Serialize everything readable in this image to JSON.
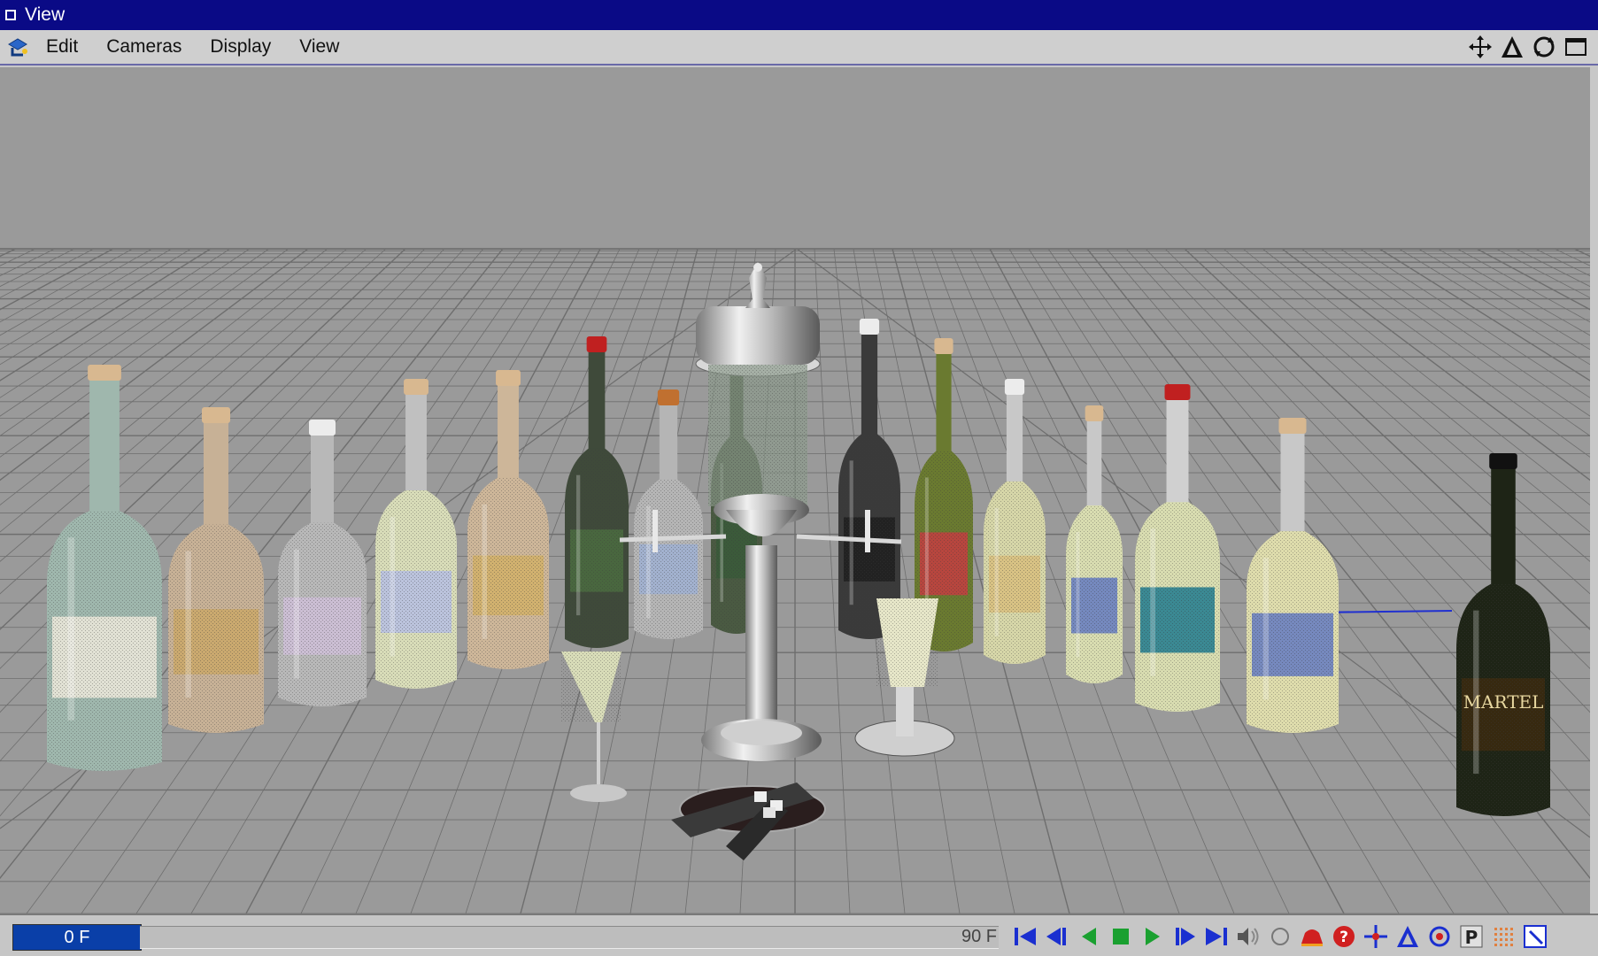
{
  "window": {
    "title": "View"
  },
  "menu": {
    "items": [
      {
        "id": "edit",
        "label": "Edit"
      },
      {
        "id": "cameras",
        "label": "Cameras"
      },
      {
        "id": "display",
        "label": "Display"
      },
      {
        "id": "view",
        "label": "View"
      }
    ]
  },
  "nav_icons": [
    "move-view-icon",
    "zoom-view-icon",
    "rotate-view-icon",
    "maximize-view-icon"
  ],
  "timeline": {
    "current_frame": "0 F",
    "end_frame": "90 F",
    "progress": 0
  },
  "viewport": {
    "background": "#9a9a9a",
    "grid_color": "#6e6e6e",
    "bottles": [
      {
        "body": "#9fb7ad",
        "neck": "#9fb7ad",
        "cap": "#d8b890",
        "label": "#e8e6d8",
        "label_text": ""
      },
      {
        "body": "#c7b196",
        "neck": "#c7b196",
        "cap": "#d8b890",
        "label": "#caa86a",
        "label_text": ""
      },
      {
        "body": "#b8b8b8",
        "neck": "#b8b8b8",
        "cap": "#ececec",
        "label": "#cdbfd6",
        "label_text": ""
      },
      {
        "body": "#d8dcb8",
        "neck": "#c0c0c0",
        "cap": "#d8b890",
        "label": "#b8c0e0",
        "label_text": ""
      },
      {
        "body": "#cdb699",
        "neck": "#cdb699",
        "cap": "#d8b890",
        "label": "#d2b06a",
        "label_text": ""
      },
      {
        "body": "#3f4a3a",
        "neck": "#3f4a3a",
        "cap": "#c02020",
        "label": "#4a6a40",
        "label_text": ""
      },
      {
        "body": "#b5b5b5",
        "neck": "#b5b5b5",
        "cap": "#c07030",
        "label": "#a0b0d0",
        "label_text": ""
      },
      {
        "body": "#4a5a42",
        "neck": "#4a5a42",
        "cap": "#d8b890",
        "label": "#3a5a3a",
        "label_text": ""
      },
      {
        "body": "#3a3a3a",
        "neck": "#3a3a3a",
        "cap": "#ececec",
        "label": "#202020",
        "label_text": ""
      },
      {
        "body": "#6a7a30",
        "neck": "#6a7a30",
        "cap": "#d8b890",
        "label": "#c04040",
        "label_text": ""
      },
      {
        "body": "#d6d6a8",
        "neck": "#c8c8c8",
        "cap": "#ececec",
        "label": "#d8c080",
        "label_text": ""
      },
      {
        "body": "#d8dcb0",
        "neck": "#c8c8c8",
        "cap": "#d8b890",
        "label": "#6a80c0",
        "label_text": ""
      },
      {
        "body": "#d8dcb0",
        "neck": "#d0d0d0",
        "cap": "#c02020",
        "label": "#2a8090",
        "label_text": ""
      },
      {
        "body": "#dedcac",
        "neck": "#c8c8c8",
        "cap": "#d8b890",
        "label": "#6a80c0",
        "label_text": ""
      },
      {
        "body": "#1e2416",
        "neck": "#1e2416",
        "cap": "#111111",
        "label": "#3a2a10",
        "label_text": "MARTEL"
      }
    ]
  }
}
